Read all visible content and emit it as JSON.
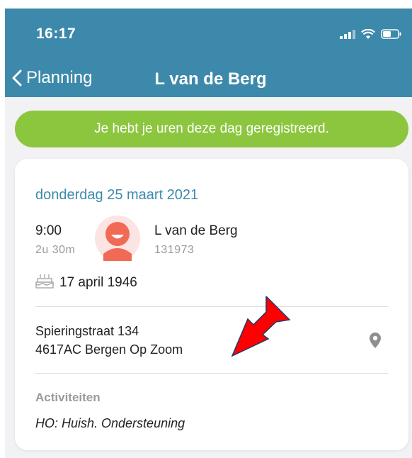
{
  "status_bar": {
    "time": "16:17"
  },
  "nav": {
    "back_label": "Planning",
    "title": "L van de Berg"
  },
  "banner": {
    "text": "Je hebt je uren deze dag geregistreerd."
  },
  "appointment": {
    "date": "donderdag 25 maart 2021",
    "start_time": "9:00",
    "duration": "2u 30m",
    "client_name": "L van de Berg",
    "client_number": "131973",
    "birth_date": "17 april 1946",
    "address_line1": "Spieringstraat 134",
    "address_line2": "4617AC Bergen Op Zoom",
    "activities_label": "Activiteiten",
    "activity": "HO: Huish. Ondersteuning"
  },
  "icons": {
    "back": "chevron-left-icon",
    "signal": "signal-icon",
    "wifi": "wifi-icon",
    "battery": "battery-icon",
    "avatar": "avatar-icon",
    "birthday": "birthday-cake-icon",
    "location": "location-pin-icon",
    "annotation": "red-arrow-icon"
  },
  "colors": {
    "header": "#3d89ab",
    "banner": "#8cc63f",
    "accent_text": "#3d89ab",
    "avatar": "#f06a55",
    "arrow": "#ff0000"
  }
}
